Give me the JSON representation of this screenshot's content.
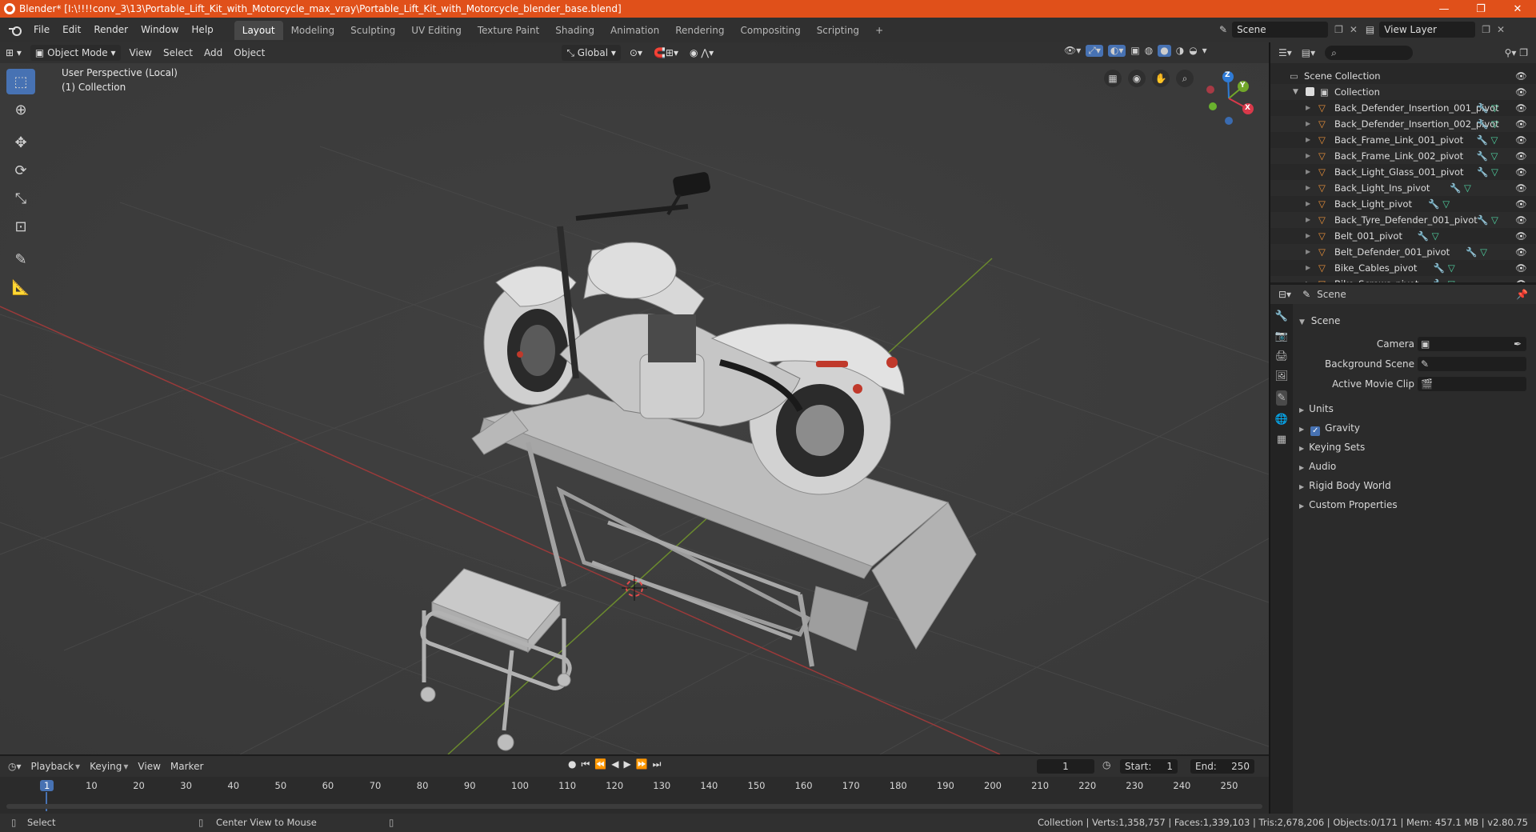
{
  "window": {
    "title": "Blender* [I:\\!!!!conv_3\\13\\Portable_Lift_Kit_with_Motorcycle_max_vray\\Portable_Lift_Kit_with_Motorcycle_blender_base.blend]",
    "minimize": "—",
    "maximize": "❐",
    "close": "✕"
  },
  "menu": {
    "file": "File",
    "edit": "Edit",
    "render": "Render",
    "window": "Window",
    "help": "Help"
  },
  "workspaces": [
    "Layout",
    "Modeling",
    "Sculpting",
    "UV Editing",
    "Texture Paint",
    "Shading",
    "Animation",
    "Rendering",
    "Compositing",
    "Scripting"
  ],
  "add_workspace": "+",
  "scene_field": "Scene",
  "view_layer_field": "View Layer",
  "viewport": {
    "mode": "Object Mode",
    "view": "View",
    "select": "Select",
    "add": "Add",
    "object": "Object",
    "orientation": "Global",
    "overlay_line1": "User Perspective (Local)",
    "overlay_line2": "(1) Collection",
    "gizmo_z": "Z",
    "gizmo_y": "Y",
    "gizmo_x": "X"
  },
  "outliner": {
    "search_placeholder": "",
    "scene_collection": "Scene Collection",
    "collection": "Collection",
    "items": [
      "Back_Defender_Insertion_001_pivot",
      "Back_Defender_Insertion_002_pivot",
      "Back_Frame_Link_001_pivot",
      "Back_Frame_Link_002_pivot",
      "Back_Light_Glass_001_pivot",
      "Back_Light_Ins_pivot",
      "Back_Light_pivot",
      "Back_Tyre_Defender_001_pivot",
      "Belt_001_pivot",
      "Belt_Defender_001_pivot",
      "Bike_Cables_pivot",
      "Bike_Screws_pivot"
    ]
  },
  "properties": {
    "header": "Scene",
    "section": "Scene",
    "camera_label": "Camera",
    "background_scene_label": "Background Scene",
    "active_movie_clip_label": "Active Movie Clip",
    "panels": [
      "Units",
      "Gravity",
      "Keying Sets",
      "Audio",
      "Rigid Body World",
      "Custom Properties"
    ]
  },
  "timeline": {
    "playback": "Playback",
    "keying": "Keying",
    "view": "View",
    "marker": "Marker",
    "current_frame": "1",
    "start_label": "Start:",
    "start": "1",
    "end_label": "End:",
    "end": "250",
    "ruler": [
      "1",
      "10",
      "20",
      "30",
      "40",
      "50",
      "60",
      "70",
      "80",
      "90",
      "100",
      "110",
      "120",
      "130",
      "140",
      "150",
      "160",
      "170",
      "180",
      "190",
      "200",
      "210",
      "220",
      "230",
      "240",
      "250"
    ]
  },
  "status": {
    "select": "Select",
    "center_view": "Center View to Mouse",
    "stats": "Collection | Verts:1,358,757 | Faces:1,339,103 | Tris:2,678,206 | Objects:0/171 | Mem: 457.1 MB | v2.80.75"
  },
  "colors": {
    "accent": "#4772b3",
    "titlebar": "#e0501a",
    "pivot_orange": "#e8903a",
    "modifier_blue": "#6ea8ff",
    "mesh_green": "#4fd1a0"
  }
}
